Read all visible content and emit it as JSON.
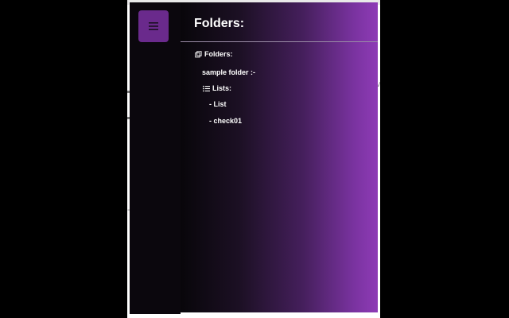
{
  "sidebar": {
    "menu_icon": "hamburger-menu-icon",
    "accent": "#6a2a8c"
  },
  "panel": {
    "title": "Folders:",
    "gradient_start": "#08060a",
    "gradient_end": "#8e3bb6",
    "section_icon": "copy-folders-icon",
    "section_label": "Folders:",
    "folder": {
      "label": "sample folder :-",
      "lists_icon": "list-icon",
      "lists_label": "Lists:",
      "items": [
        "- List",
        "- check01"
      ]
    }
  },
  "background": {
    "right_char": "v",
    "left_char": "-"
  }
}
